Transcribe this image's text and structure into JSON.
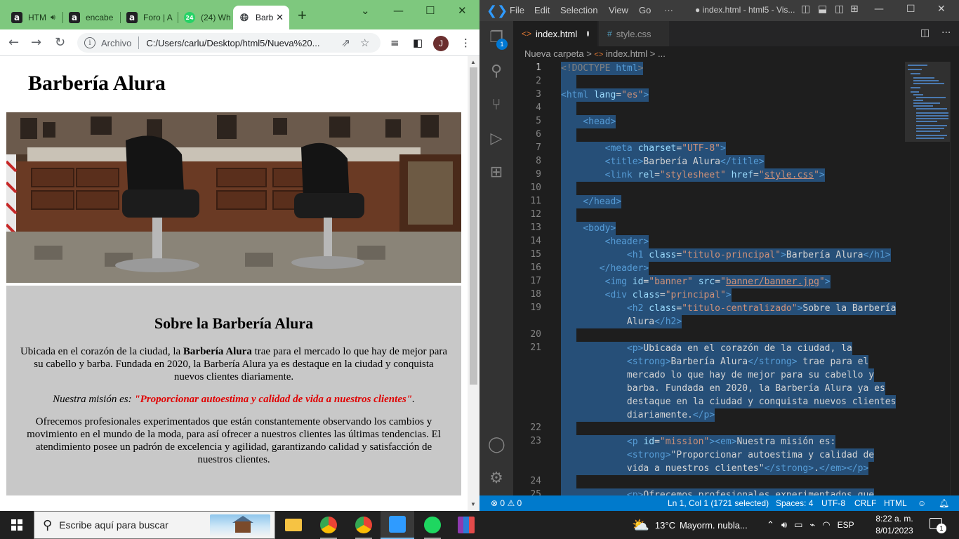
{
  "chrome": {
    "tabs": [
      {
        "label": "HTM",
        "favicon": "a",
        "muted_icon": "speaker-icon"
      },
      {
        "label": "encabe",
        "favicon": "a"
      },
      {
        "label": "Foro | A",
        "favicon": "a"
      },
      {
        "label": "(24) Wh",
        "favicon": "24"
      },
      {
        "label": "Barb",
        "favicon": "globe-icon"
      }
    ],
    "new_tab": "+",
    "window_controls": {
      "chevron": "⌄",
      "minimize": "—",
      "maximize": "☐",
      "close": "✕"
    },
    "omnibox": {
      "scheme_label": "Archivo",
      "url": "C:/Users/carlu/Desktop/html5/Nueva%20..."
    },
    "profile_initial": "J"
  },
  "page": {
    "h1": "Barbería Alura",
    "h2": "Sobre la Barbería Alura",
    "p1_before": "Ubicada en el corazón de la ciudad, la ",
    "p1_strong": "Barbería Alura",
    "p1_after": " trae para el mercado lo que hay de mejor para su cabello y barba. Fundada en 2020, la Barbería Alura ya es destaque en la ciudad y conquista nuevos clientes diariamente.",
    "mission_em": "Nuestra misión es: ",
    "mission_strong": "\"Proporcionar autoestima y calidad de vida a nuestros clientes\"",
    "mission_end": ".",
    "p3": "Ofrecemos profesionales experimentados que están constantemente observando los cambios y movimiento en el mundo de la moda, para así ofrecer a nuestros clientes las últimas tendencias. El atendimiento posee un padrón de excelencia y agilidad, garantizando calidad y satisfacción de nuestros clientes."
  },
  "vscode": {
    "menu": [
      "File",
      "Edit",
      "Selection",
      "View",
      "Go",
      "···"
    ],
    "window_title": "● index.html - html5 - Vis...",
    "explorer_badge": "1",
    "tabs": [
      {
        "label": "index.html",
        "icon": "<>",
        "dirty": true
      },
      {
        "label": "style.css",
        "icon": "#",
        "dirty": false
      }
    ],
    "breadcrumb": {
      "folder": "Nueva carpeta",
      "file": "index.html",
      "more": "..."
    },
    "line_numbers": [
      "1",
      "2",
      "3",
      "4",
      "5",
      "6",
      "7",
      "8",
      "9",
      "10",
      "11",
      "12",
      "13",
      "14",
      "15",
      "16",
      "17",
      "18",
      "19",
      "",
      "20",
      "21",
      "",
      "",
      "",
      "",
      "",
      "22",
      "23",
      "",
      "",
      "24",
      "25"
    ],
    "code": {
      "l1": [
        "<!DOCTYPE ",
        "html",
        ">"
      ],
      "l3": [
        "<html ",
        "lang",
        "=",
        "\"es\"",
        ">"
      ],
      "l5": [
        "<head>"
      ],
      "l7": [
        "<meta ",
        "charset",
        "=",
        "\"UTF-8\"",
        ">"
      ],
      "l8": [
        "<title>",
        "Barbería Alura",
        "</title>"
      ],
      "l9": [
        "<link ",
        "rel",
        "=",
        "\"stylesheet\"",
        " href",
        "=",
        "\"",
        "style.css",
        "\"",
        ">"
      ],
      "l11": [
        "</head>"
      ],
      "l13": [
        "<body>"
      ],
      "l14": [
        "<header>"
      ],
      "l15": [
        "<h1 ",
        "class",
        "=",
        "\"titulo-principal\"",
        ">",
        "Barbería Alura",
        "</h1>"
      ],
      "l16": [
        "</header>"
      ],
      "l17": [
        "<img ",
        "id",
        "=",
        "\"banner\"",
        " src",
        "=",
        "\"",
        "banner/banner.jpg",
        "\"",
        ">"
      ],
      "l18": [
        "<div ",
        "class",
        "=",
        "\"principal\"",
        ">"
      ],
      "l19a": [
        "<h2 ",
        "class",
        "=",
        "\"titulo-centralizado\"",
        ">",
        "Sobre la Barbería"
      ],
      "l19b": [
        "Alura",
        "</h2>"
      ],
      "l21a": [
        "<p>",
        "Ubicada en el corazón de la ciudad, la"
      ],
      "l21b": [
        "<strong>",
        "Barbería Alura",
        "</strong>",
        " trae para el"
      ],
      "l21c": [
        "mercado lo que hay de mejor para su cabello y"
      ],
      "l21d": [
        "barba. Fundada en 2020, la Barbería Alura ya es"
      ],
      "l21e": [
        "destaque en la ciudad y conquista nuevos clientes"
      ],
      "l21f": [
        "diariamente.",
        "</p>"
      ],
      "l23a": [
        "<p ",
        "id",
        "=",
        "\"mission\"",
        ">",
        "<em>",
        "Nuestra misión es:"
      ],
      "l23b": [
        "<strong>",
        "\"Proporcionar autoestima y calidad de"
      ],
      "l23c": [
        "vida a nuestros clientes\"",
        "</strong>",
        ".",
        "</em>",
        "</p>"
      ],
      "l25": [
        "<p>",
        "Ofrecemos profesionales experimentados que"
      ]
    },
    "status": {
      "errors": "0",
      "warnings": "0",
      "position": "Ln 1, Col 1 (1721 selected)",
      "spaces": "Spaces: 4",
      "encoding": "UTF-8",
      "eol": "CRLF",
      "language": "HTML",
      "notifications": "1"
    }
  },
  "taskbar": {
    "search_placeholder": "Escribe aquí para buscar",
    "weather_temp": "13°C",
    "weather_text": "Mayorm. nubla...",
    "language": "ESP",
    "time": "8:22 a. m.",
    "date": "8/01/2023",
    "notification_count": "1"
  },
  "colors": {
    "chrome_frame": "#7ec87e",
    "vscode_status": "#007acc",
    "selection": "#264f78",
    "mission_red": "#e00000"
  }
}
